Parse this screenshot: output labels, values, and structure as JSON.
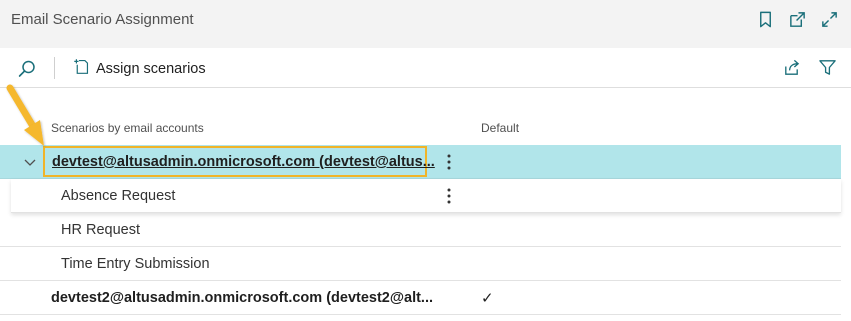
{
  "page": {
    "title": "Email Scenario Assignment"
  },
  "title_actions": [
    "bookmark-icon",
    "open-new-window-icon",
    "expand-icon"
  ],
  "toolbar": {
    "assign_label": "Assign scenarios"
  },
  "columns": {
    "scenarios": "Scenarios by email accounts",
    "default": "Default"
  },
  "rows": [
    {
      "label": "devtest@altusadmin.onmicrosoft.com (devtest@altus...",
      "type": "account",
      "expanded": true,
      "selected": true
    },
    {
      "label": "Absence Request",
      "type": "scenario"
    },
    {
      "label": "HR Request",
      "type": "scenario"
    },
    {
      "label": "Time Entry Submission",
      "type": "scenario"
    },
    {
      "label": "devtest2@altusadmin.onmicrosoft.com (devtest2@alt...",
      "type": "account",
      "default_mark": "✓"
    }
  ],
  "colors": {
    "selected_row": "#b1e5ea",
    "focus_border": "#f0b429",
    "accent": "#1a6f7a"
  }
}
